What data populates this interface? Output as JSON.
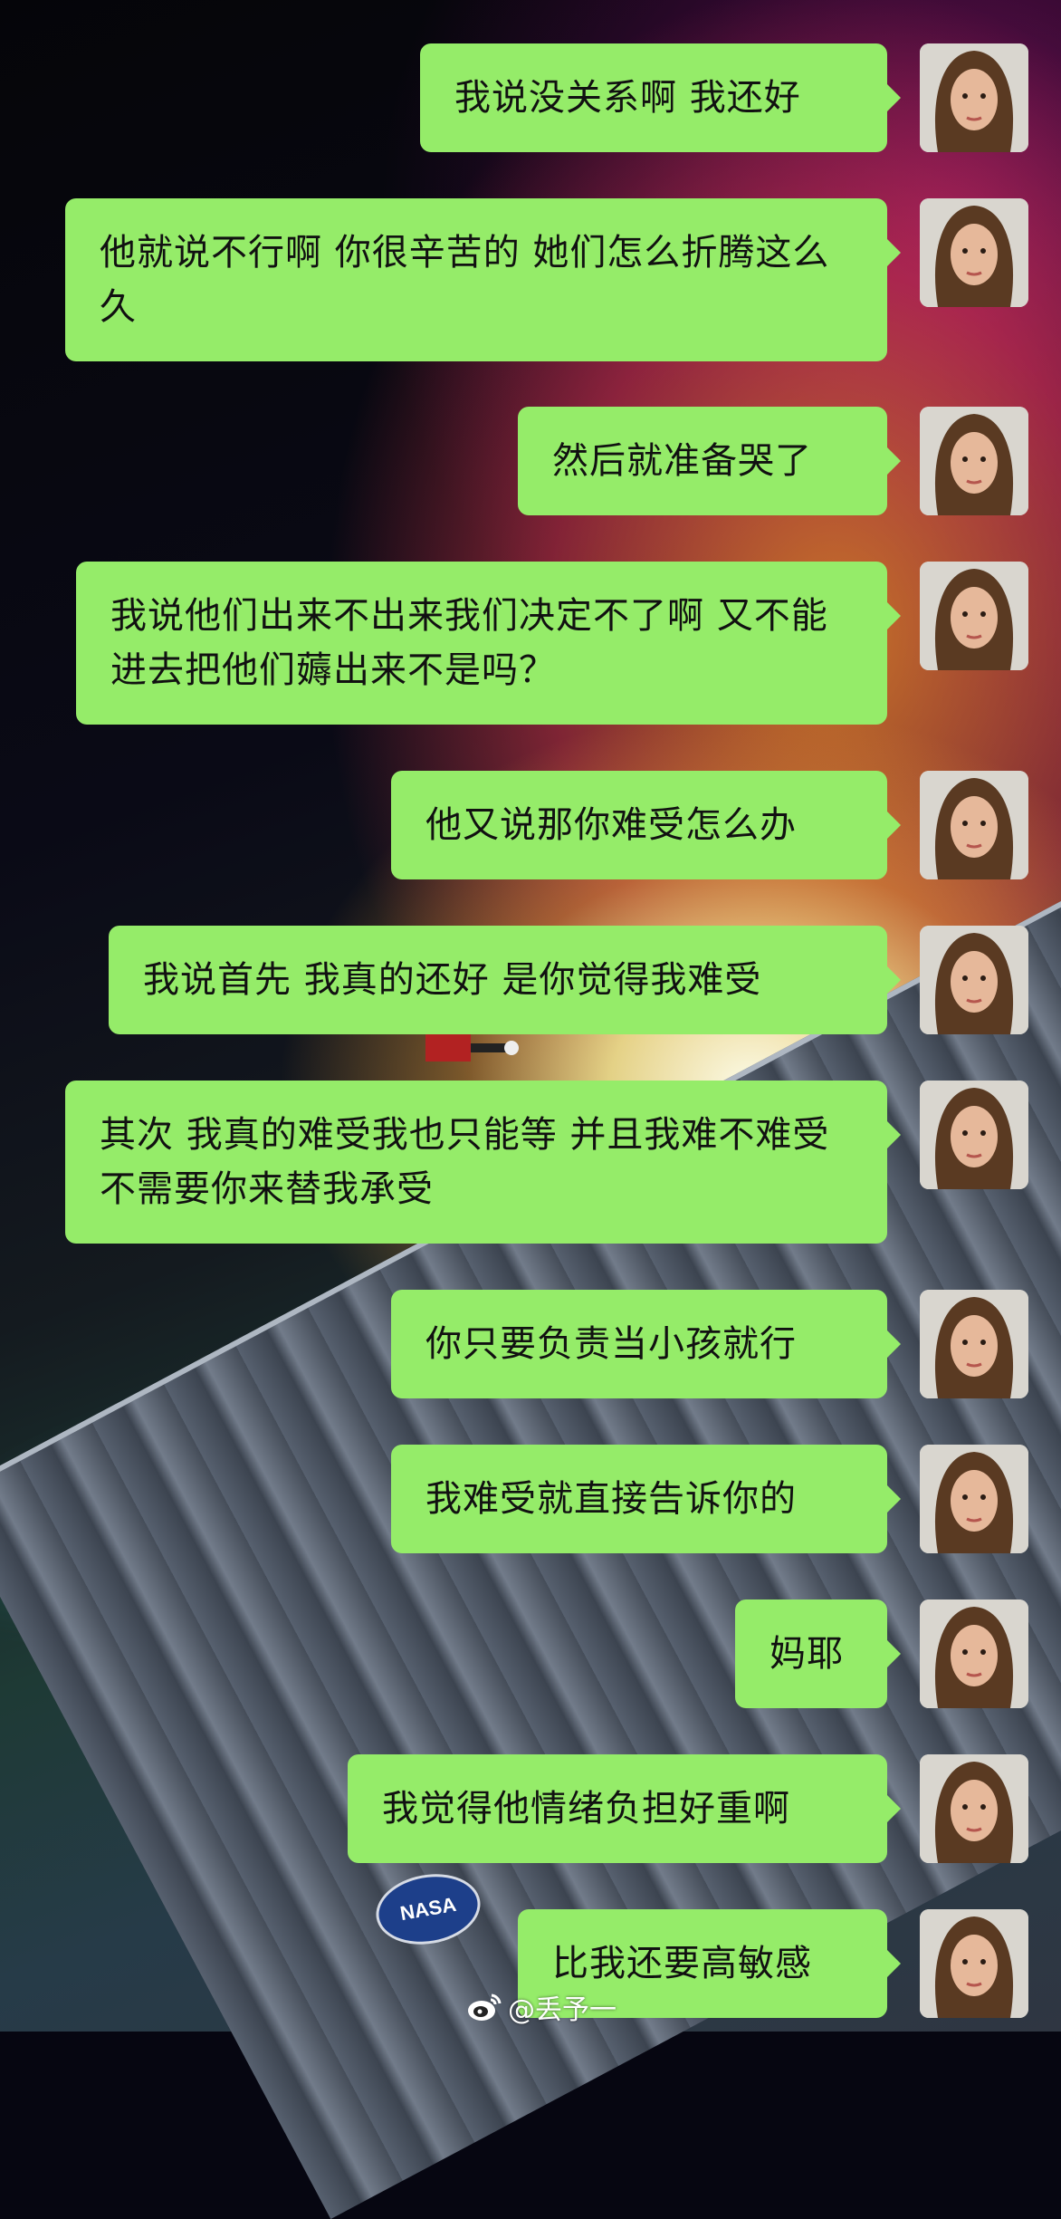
{
  "conversation": {
    "messages": [
      {
        "text": "我说没关系啊 我还好",
        "side": "right"
      },
      {
        "text": "他就说不行啊 你很辛苦的 她们怎么折腾这么久",
        "side": "right"
      },
      {
        "text": "然后就准备哭了",
        "side": "right"
      },
      {
        "text": "我说他们出来不出来我们决定不了啊 又不能进去把他们薅出来不是吗？",
        "side": "right"
      },
      {
        "text": "他又说那你难受怎么办",
        "side": "right"
      },
      {
        "text": "我说首先 我真的还好 是你觉得我难受",
        "side": "right"
      },
      {
        "text": "其次 我真的难受我也只能等 并且我难不难受不需要你来替我承受",
        "side": "right"
      },
      {
        "text": "你只要负责当小孩就行",
        "side": "right"
      },
      {
        "text": "我难受就直接告诉你的",
        "side": "right"
      },
      {
        "text": "妈耶",
        "side": "right"
      },
      {
        "text": "我觉得他情绪负担好重啊",
        "side": "right"
      },
      {
        "text": "比我还要高敏感",
        "side": "right"
      }
    ]
  },
  "background": {
    "patch_text": "NASA"
  },
  "watermark": {
    "icon": "weibo-icon",
    "text": "@丢予一"
  },
  "colors": {
    "bubble": "#95ec69",
    "text": "#111111"
  }
}
